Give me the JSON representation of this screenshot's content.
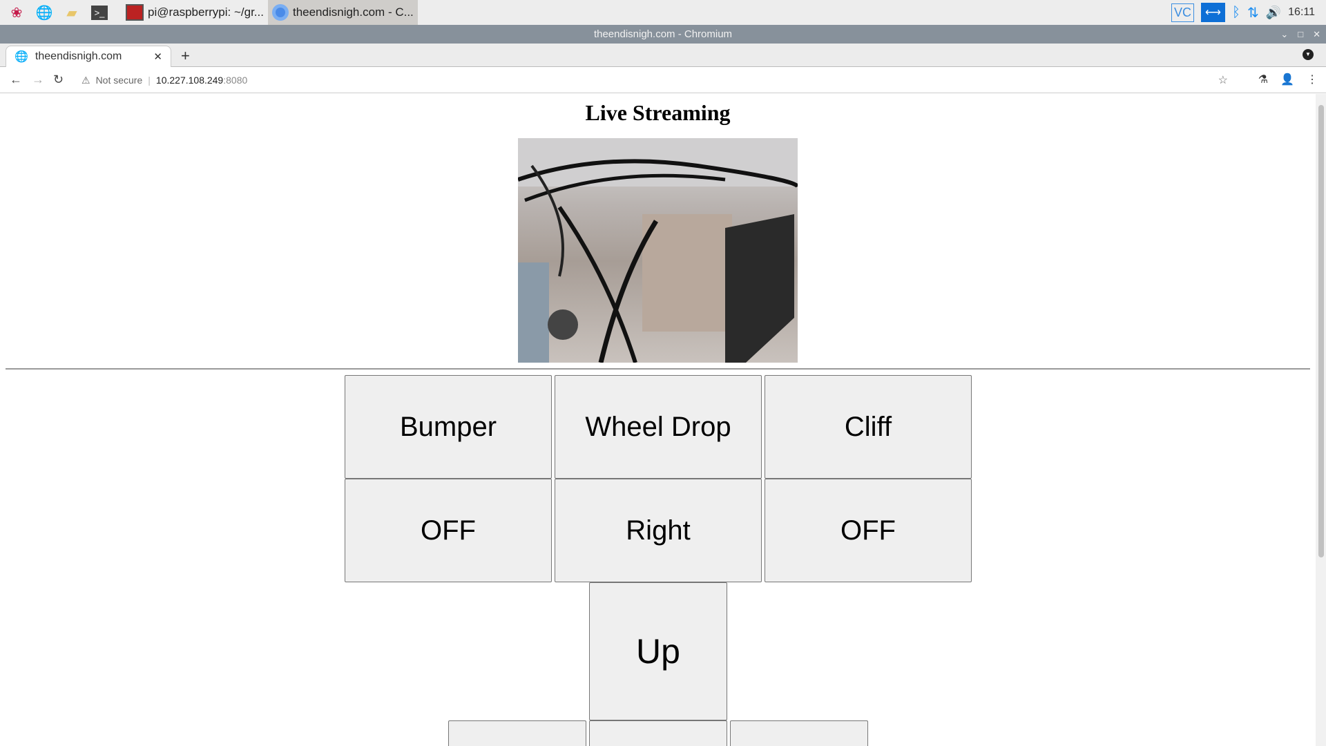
{
  "taskbar": {
    "tasks": [
      {
        "label": "pi@raspberrypi: ~/gr..."
      },
      {
        "label": "theendisnigh.com - C..."
      }
    ],
    "clock": "16:11",
    "vnc": "VC"
  },
  "window": {
    "title": "theendisnigh.com - Chromium"
  },
  "browser": {
    "tab_title": "theendisnigh.com",
    "not_secure": "Not secure",
    "host": "10.227.108.249",
    "port": ":8080"
  },
  "page": {
    "heading": "Live Streaming",
    "buttons": {
      "bumper": "Bumper",
      "wheel_drop": "Wheel Drop",
      "cliff": "Cliff",
      "bumper_state": "OFF",
      "wheel_drop_state": "Right",
      "cliff_state": "OFF",
      "up": "Up"
    }
  }
}
